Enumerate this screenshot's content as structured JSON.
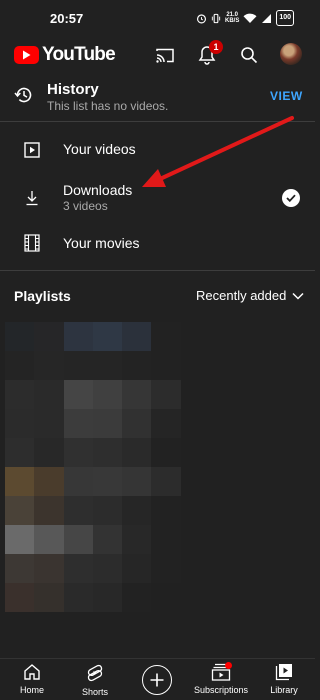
{
  "status_bar": {
    "time": "20:57",
    "speed_value": "21.0",
    "speed_unit": "KB/S",
    "battery": "100"
  },
  "app_bar": {
    "logo_text": "YouTube",
    "notification_count": "1"
  },
  "history": {
    "title": "History",
    "subtitle": "This list has no videos.",
    "action_label": "VIEW"
  },
  "library_items": [
    {
      "label": "Your videos",
      "subtitle": ""
    },
    {
      "label": "Downloads",
      "subtitle": "3 videos"
    },
    {
      "label": "Your movies",
      "subtitle": ""
    }
  ],
  "playlists": {
    "heading": "Playlists",
    "sort_label": "Recently added"
  },
  "bottom_nav": [
    {
      "label": "Home"
    },
    {
      "label": "Shorts"
    },
    {
      "label": ""
    },
    {
      "label": "Subscriptions"
    },
    {
      "label": "Library"
    }
  ],
  "colors": {
    "background": "#212121",
    "accent_red": "#ff0000",
    "link_blue": "#3ea6ff",
    "arrow_red": "#e11919"
  }
}
